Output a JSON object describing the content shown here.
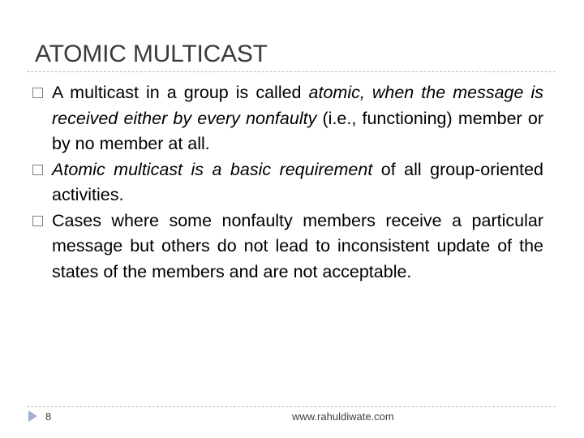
{
  "slide": {
    "title": "ATOMIC MULTICAST",
    "bullets": [
      {
        "segments": [
          {
            "text": "A multicast in a group is called ",
            "italic": false
          },
          {
            "text": "atomic, when the message is received either by every nonfaulty",
            "italic": true
          },
          {
            "text": " (i.e., functioning) member or by no member at all.",
            "italic": false
          }
        ]
      },
      {
        "segments": [
          {
            "text": "Atomic multicast is a basic requirement",
            "italic": true
          },
          {
            "text": " of all group-oriented activities.",
            "italic": false
          }
        ]
      },
      {
        "segments": [
          {
            "text": "Cases where some nonfaulty members receive a particular message but others do not lead to inconsistent update of the states of the members and are not acceptable.",
            "italic": false
          }
        ]
      }
    ],
    "footer": {
      "page_number": "8",
      "url": "www.rahuldiwate.com"
    }
  }
}
